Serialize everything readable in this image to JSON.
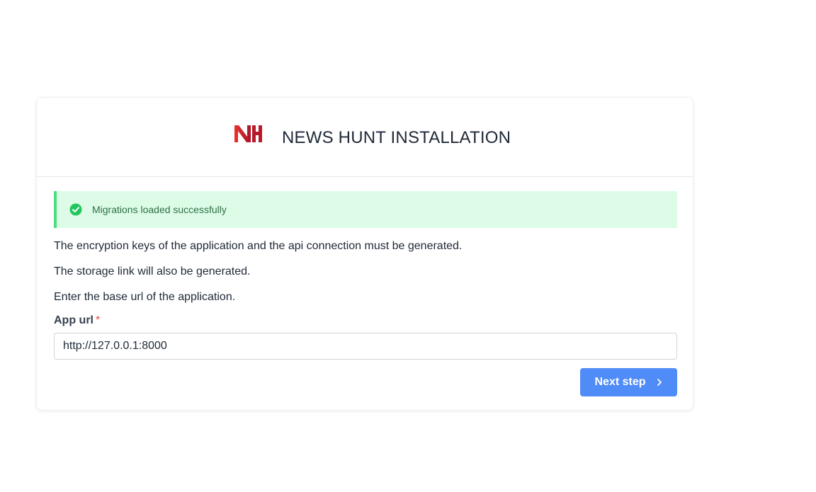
{
  "header": {
    "logo_text": "NH",
    "title": "NEWS HUNT INSTALLATION"
  },
  "alert": {
    "icon": "check-circle-icon",
    "message": "Migrations loaded successfully"
  },
  "body": {
    "paragraphs": [
      "The encryption keys of the application and the api connection must be generated.",
      "The storage link will also be generated.",
      "Enter the base url of the application."
    ]
  },
  "form": {
    "app_url_label": "App url",
    "required_mark": "*",
    "app_url_value": "http://127.0.0.1:8000"
  },
  "actions": {
    "next_label": "Next step",
    "next_icon": "chevron-right-icon"
  },
  "colors": {
    "primary": "#4f8cf7",
    "success_bg": "#dcfce7",
    "success_border": "#4ade80",
    "success_icon": "#22c55e",
    "logo_red": "#d9232e"
  }
}
